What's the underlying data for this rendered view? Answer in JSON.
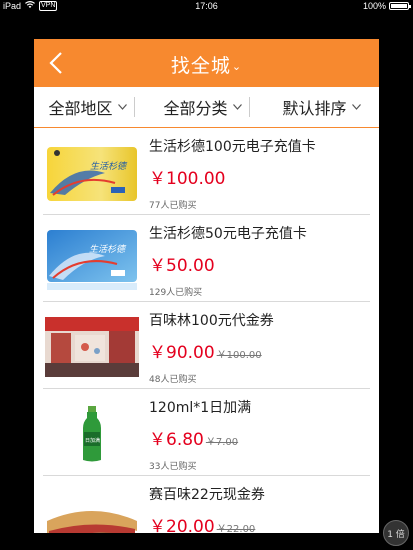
{
  "status": {
    "device": "iPad",
    "vpn": "VPN",
    "time": "17:06",
    "battery_text": "100%",
    "battery_level": 1.0
  },
  "nav": {
    "title": "找全城",
    "title_caret": "⌄"
  },
  "filters": [
    {
      "label": "全部地区"
    },
    {
      "label": "全部分类"
    },
    {
      "label": "默认排序"
    }
  ],
  "items": [
    {
      "title": "生活杉德100元电子充值卡",
      "price": "￥100.00",
      "old_price": "",
      "sold": "77人已购买",
      "image": "sand-card-icon"
    },
    {
      "title": "生活杉德50元电子充值卡",
      "price": "￥50.00",
      "old_price": "",
      "sold": "129人已购买",
      "image": "sand-card-icon"
    },
    {
      "title": "百味林100元代金券",
      "price": "￥90.00",
      "old_price": "￥100.00",
      "sold": "48人已购买",
      "image": "store-icon"
    },
    {
      "title": "120ml*1日加满",
      "price": "￥6.80",
      "old_price": "￥7.00",
      "sold": "33人已购买",
      "image": "bottle-icon"
    },
    {
      "title": "赛百味22元现金券",
      "price": "￥20.00",
      "old_price": "￥22.00",
      "sold": "",
      "image": "sandwich-icon"
    }
  ],
  "pager": {
    "label": "1 倍"
  },
  "colors": {
    "accent": "#f7892f",
    "price": "#e4001e"
  }
}
